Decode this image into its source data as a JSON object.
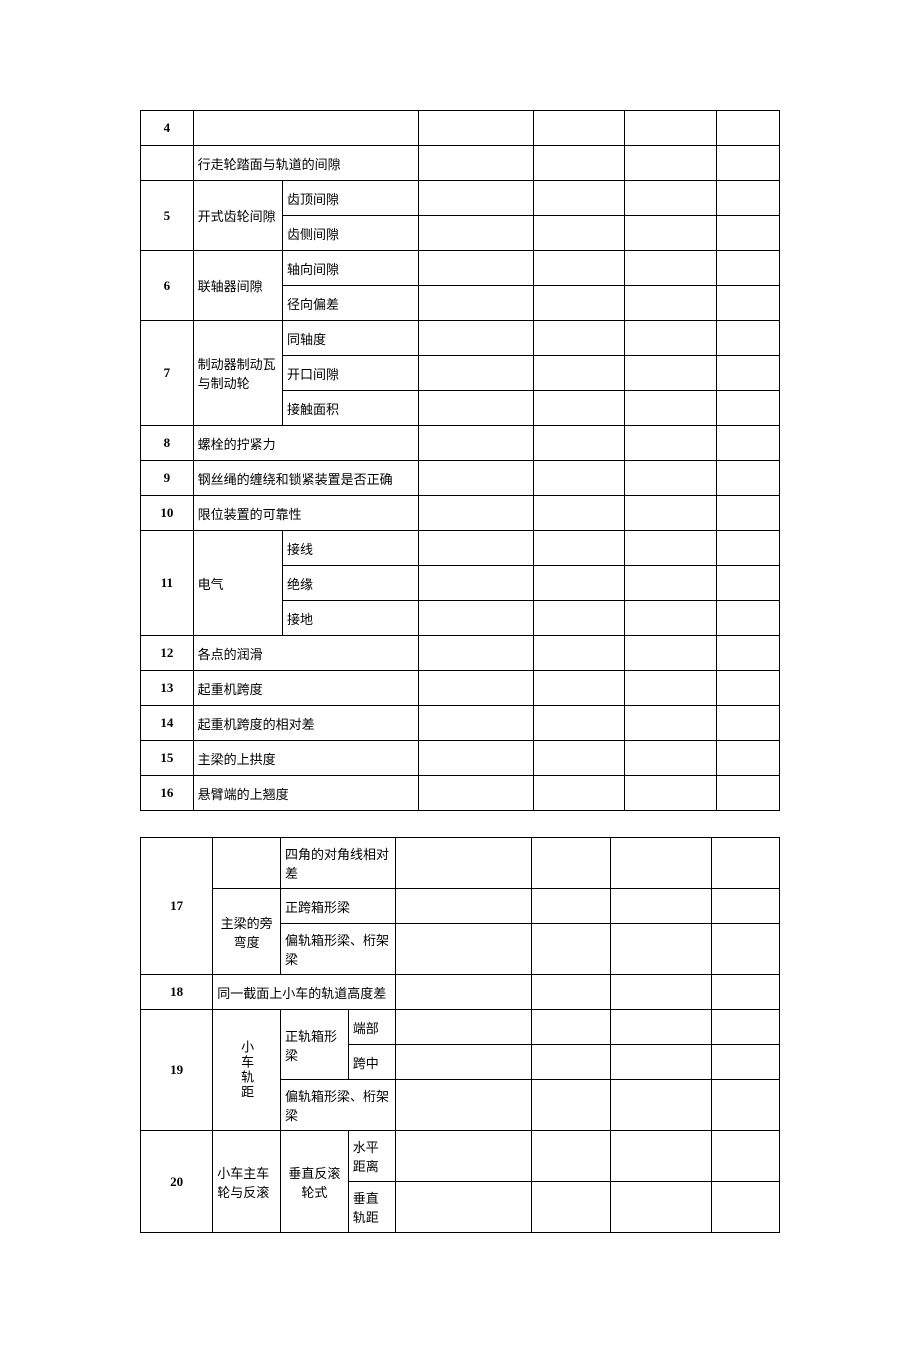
{
  "table1": {
    "rows": {
      "r4": {
        "num": "4",
        "text": "行走轮踏面与轨道的间隙"
      },
      "r5": {
        "num": "5",
        "label": "开式齿轮间隙",
        "sub1": "齿顶间隙",
        "sub2": "齿侧间隙"
      },
      "r6": {
        "num": "6",
        "label": "联轴器间隙",
        "sub1": "轴向间隙",
        "sub2": "径向偏差"
      },
      "r7": {
        "num": "7",
        "label": "制动器制动瓦与制动轮",
        "sub1": "同轴度",
        "sub2": "开口间隙",
        "sub3": "接触面积"
      },
      "r8": {
        "num": "8",
        "text": "螺栓的拧紧力"
      },
      "r9": {
        "num": "9",
        "text": "钢丝绳的缠绕和锁紧装置是否正确"
      },
      "r10": {
        "num": "10",
        "text": "限位装置的可靠性"
      },
      "r11": {
        "num": "11",
        "label": "电气",
        "sub1": "接线",
        "sub2": "绝缘",
        "sub3": "接地"
      },
      "r12": {
        "num": "12",
        "text": "各点的润滑"
      },
      "r13": {
        "num": "13",
        "text": "起重机跨度"
      },
      "r14": {
        "num": "14",
        "text": "起重机跨度的相对差"
      },
      "r15": {
        "num": "15",
        "text": "主梁的上拱度"
      },
      "r16": {
        "num": "16",
        "text": "悬臂端的上翘度"
      }
    }
  },
  "table2": {
    "rows": {
      "r0": {
        "diag": "四角的对角线相对差"
      },
      "r17": {
        "num": "17",
        "label": "主梁的旁弯度",
        "sub1": "正跨箱形梁",
        "sub2": "偏轨箱形梁、桁架梁"
      },
      "r18": {
        "num": "18",
        "text": "同一截面上小车的轨道高度差"
      },
      "r19": {
        "num": "19",
        "label": "小车轨距",
        "g1": "正轨箱形梁",
        "g1s1": "端部",
        "g1s2": "跨中",
        "g2": "偏轨箱形梁、桁架梁"
      },
      "r20": {
        "num": "20",
        "label": "小车主车轮与反滚",
        "g1": "垂直反滚轮式",
        "g1s1": "水平距离",
        "g1s2": "垂直轨距"
      }
    }
  }
}
